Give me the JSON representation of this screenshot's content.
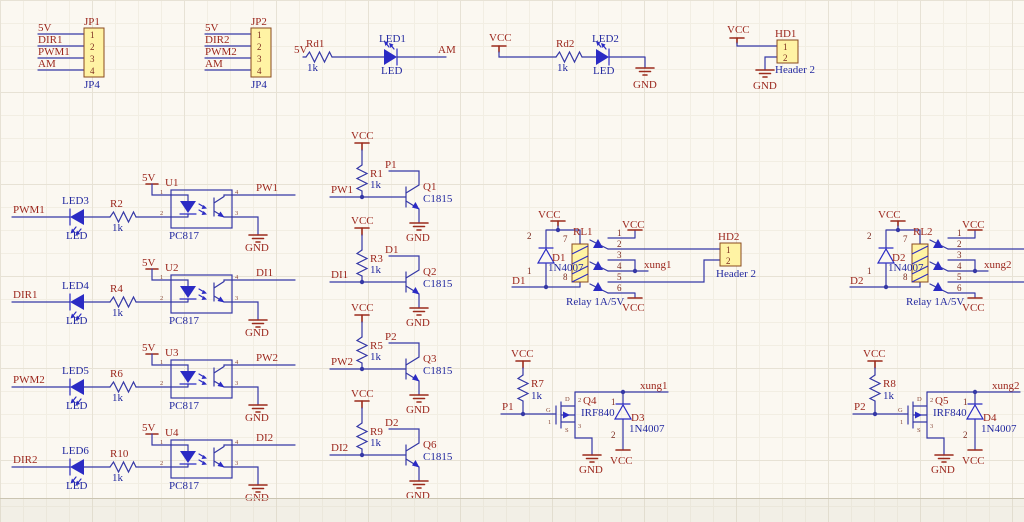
{
  "power": {
    "vcc": "VCC",
    "gnd": "GND",
    "v5": "5V"
  },
  "nets": {
    "pwm1": "PWM1",
    "dir1": "DIR1",
    "pwm2": "PWM2",
    "dir2": "DIR2",
    "am": "AM",
    "pw1": "PW1",
    "pw2": "PW2",
    "di1": "DI1",
    "di2": "DI2",
    "p1": "P1",
    "p2": "P2",
    "d1": "D1",
    "d2": "D2",
    "xung1": "xung1",
    "xung2": "xung2"
  },
  "pins": {
    "n1": "1",
    "n2": "2",
    "n3": "3",
    "n4": "4",
    "n5": "5",
    "n6": "6",
    "n7": "7",
    "n8": "8",
    "g": "G",
    "d": "D",
    "s": "S"
  },
  "parts": {
    "jp1": {
      "ref": "JP1",
      "value": "JP4"
    },
    "jp2": {
      "ref": "JP2",
      "value": "JP4"
    },
    "rd1": {
      "ref": "Rd1",
      "value": "1k"
    },
    "rd2": {
      "ref": "Rd2",
      "value": "1k"
    },
    "led1": {
      "ref": "LED1",
      "value": "LED"
    },
    "led2": {
      "ref": "LED2",
      "value": "LED"
    },
    "led3": {
      "ref": "LED3",
      "value": "LED"
    },
    "led4": {
      "ref": "LED4",
      "value": "LED"
    },
    "led5": {
      "ref": "LED5",
      "value": "LED"
    },
    "led6": {
      "ref": "LED6",
      "value": "LED"
    },
    "r1": {
      "ref": "R1",
      "value": "1k"
    },
    "r2": {
      "ref": "R2",
      "value": "1k"
    },
    "r3": {
      "ref": "R3",
      "value": "1k"
    },
    "r4": {
      "ref": "R4",
      "value": "1k"
    },
    "r5": {
      "ref": "R5",
      "value": "1k"
    },
    "r6": {
      "ref": "R6",
      "value": "1k"
    },
    "r7": {
      "ref": "R7",
      "value": "1k"
    },
    "r8": {
      "ref": "R8",
      "value": "1k"
    },
    "r9": {
      "ref": "R9",
      "value": "1k"
    },
    "r10": {
      "ref": "R10",
      "value": "1k"
    },
    "u1": {
      "ref": "U1",
      "value": "PC817"
    },
    "u2": {
      "ref": "U2",
      "value": "PC817"
    },
    "u3": {
      "ref": "U3",
      "value": "PC817"
    },
    "u4": {
      "ref": "U4",
      "value": "PC817"
    },
    "q1": {
      "ref": "Q1",
      "value": "C1815"
    },
    "q2": {
      "ref": "Q2",
      "value": "C1815"
    },
    "q3": {
      "ref": "Q3",
      "value": "C1815"
    },
    "q6": {
      "ref": "Q6",
      "value": "C1815"
    },
    "q4": {
      "ref": "Q4",
      "value": "IRF840"
    },
    "q5": {
      "ref": "Q5",
      "value": "IRF840"
    },
    "d1": {
      "ref": "D1",
      "value": "1N4007"
    },
    "d2": {
      "ref": "D2",
      "value": "1N4007"
    },
    "d3": {
      "ref": "D3",
      "value": "1N4007"
    },
    "d4": {
      "ref": "D4",
      "value": "1N4007"
    },
    "rl1": {
      "ref": "RL1",
      "value": "Relay 1A/5V"
    },
    "rl2": {
      "ref": "RL2",
      "value": "Relay 1A/5V"
    },
    "hd1": {
      "ref": "HD1",
      "value": "Header 2"
    },
    "hd2": {
      "ref": "HD2",
      "value": "Header 2"
    }
  },
  "colors": {
    "wire": "#3538A6",
    "symbol": "#2B2BC4",
    "text_red": "#9B261C",
    "text_blue": "#2329A0",
    "part_fill": "#FFF3A4",
    "part_border": "#8A4A1E",
    "background": "#FBF8F1"
  }
}
